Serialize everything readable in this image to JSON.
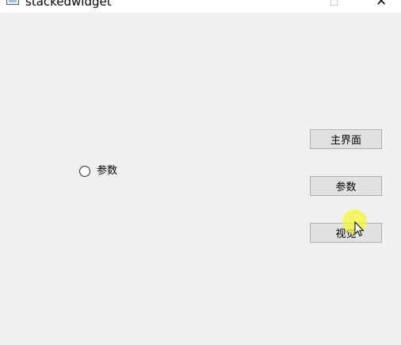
{
  "window": {
    "title": "stackedwidget"
  },
  "page": {
    "radio": {
      "label": "参数",
      "checked": false
    }
  },
  "buttons": {
    "main_label": "主界面",
    "params_label": "参数",
    "view_label": "视觉"
  },
  "cursor": {
    "highlight_color": "#f5f53c"
  }
}
